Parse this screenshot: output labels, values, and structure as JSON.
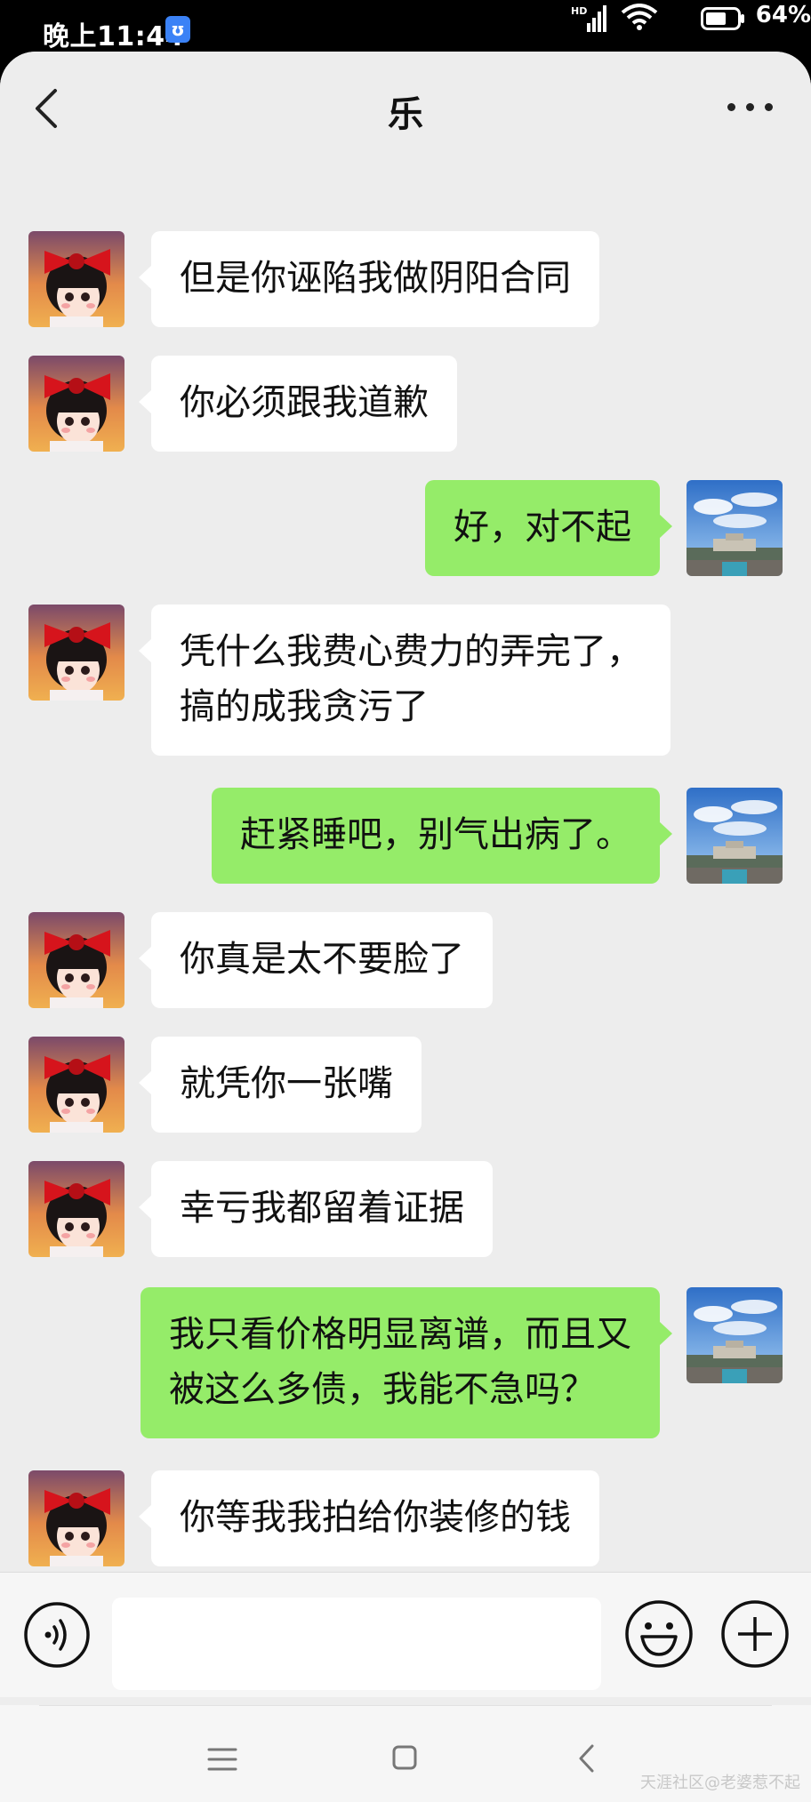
{
  "status_bar": {
    "time": "晚上11:44",
    "alarm_badge": "ʊ",
    "network_label": "HD",
    "battery_percent": "64%"
  },
  "header": {
    "title": "乐",
    "back_icon": "chevron-left-icon",
    "more_icon": "more-horizontal-icon"
  },
  "messages": [
    {
      "side": "left",
      "text": "但是你诬陷我做阴阳合同"
    },
    {
      "side": "left",
      "text": "你必须跟我道歉"
    },
    {
      "side": "right",
      "text": "好，对不起"
    },
    {
      "side": "left",
      "text": "凭什么我费心费力的弄完了，\n搞的成我贪污了"
    },
    {
      "side": "right",
      "text": "赶紧睡吧，别气出病了。"
    },
    {
      "side": "left",
      "text": "你真是太不要脸了"
    },
    {
      "side": "left",
      "text": "就凭你一张嘴"
    },
    {
      "side": "left",
      "text": "幸亏我都留着证据"
    },
    {
      "side": "right",
      "text": "我只看价格明显离谱，而且又\n被这么多债，我能不急吗？"
    },
    {
      "side": "left",
      "text": "你等我我拍给你装修的钱"
    },
    {
      "side": "left",
      "text": ""
    }
  ],
  "input_bar": {
    "voice_icon": "voice-icon",
    "text_value": "",
    "emoji_icon": "emoji-icon",
    "plus_icon": "plus-icon"
  },
  "nav_bar": {
    "menu_icon": "menu-icon",
    "home_icon": "home-icon",
    "back_icon": "back-icon"
  },
  "watermark": "天涯社区@老婆惹不起",
  "colors": {
    "chat_background": "#ededed",
    "incoming_bubble": "#ffffff",
    "outgoing_bubble": "#95ec69"
  }
}
